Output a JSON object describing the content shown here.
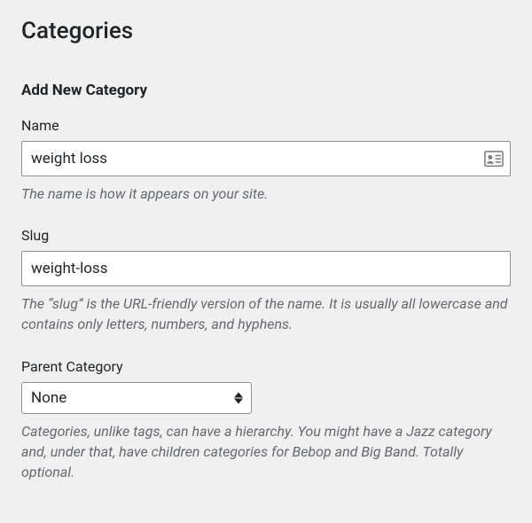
{
  "page": {
    "title": "Categories"
  },
  "form": {
    "heading": "Add New Category",
    "name": {
      "label": "Name",
      "value": "weight loss",
      "help": "The name is how it appears on your site."
    },
    "slug": {
      "label": "Slug",
      "value": "weight-loss",
      "help": "The “slug” is the URL-friendly version of the name. It is usually all lowercase and contains only letters, numbers, and hyphens."
    },
    "parent": {
      "label": "Parent Category",
      "selected": "None",
      "help": "Categories, unlike tags, can have a hierarchy. You might have a Jazz category and, under that, have children categories for Bebop and Big Band. Totally optional."
    }
  }
}
